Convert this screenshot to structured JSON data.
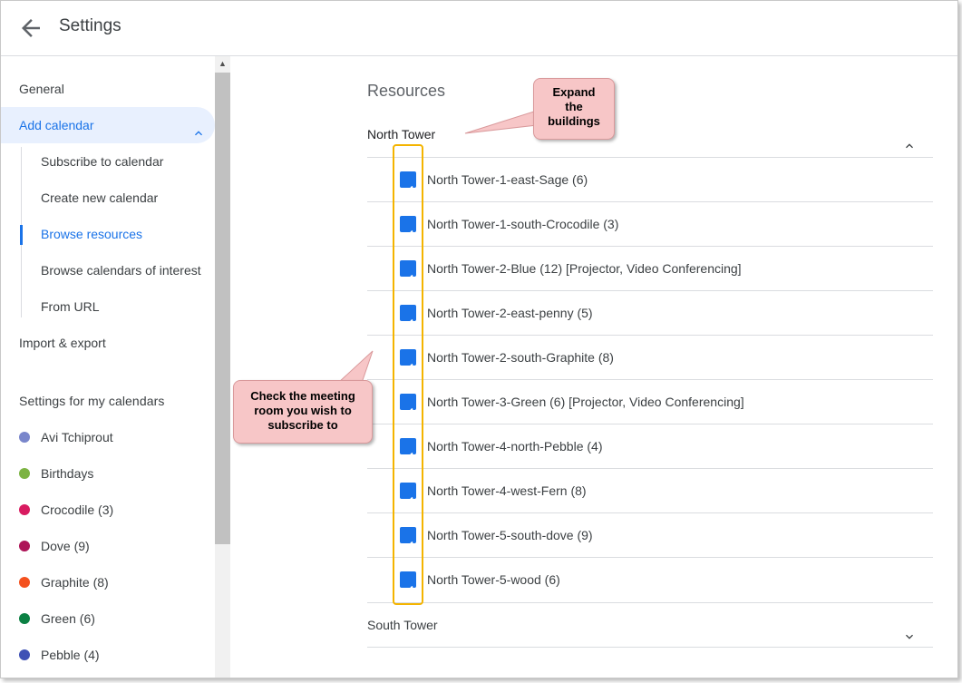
{
  "header": {
    "title": "Settings"
  },
  "sidebar": {
    "items": [
      {
        "label": "General"
      },
      {
        "label": "Add calendar"
      },
      {
        "label": "Subscribe to calendar"
      },
      {
        "label": "Create new calendar"
      },
      {
        "label": "Browse resources"
      },
      {
        "label": "Browse calendars of interest"
      },
      {
        "label": "From URL"
      },
      {
        "label": "Import & export"
      }
    ],
    "section_label": "Settings for my calendars",
    "calendars": [
      {
        "label": "Avi Tchiprout",
        "color": "#7986cb"
      },
      {
        "label": "Birthdays",
        "color": "#7cb342"
      },
      {
        "label": "Crocodile (3)",
        "color": "#d81b60"
      },
      {
        "label": "Dove (9)",
        "color": "#ad1457"
      },
      {
        "label": "Graphite (8)",
        "color": "#f4511e"
      },
      {
        "label": "Green (6)",
        "color": "#0b8043"
      },
      {
        "label": "Pebble (4)",
        "color": "#3f51b5"
      }
    ]
  },
  "main": {
    "title": "Resources",
    "buildings": [
      {
        "name": "North Tower",
        "expanded": true
      },
      {
        "name": "South Tower",
        "expanded": false
      }
    ],
    "rooms": [
      {
        "label": "North Tower-1-east-Sage (6)",
        "checked": true
      },
      {
        "label": "North Tower-1-south-Crocodile (3)",
        "checked": true
      },
      {
        "label": "North Tower-2-Blue (12) [Projector, Video Conferencing]",
        "checked": true
      },
      {
        "label": "North Tower-2-east-penny (5)",
        "checked": true
      },
      {
        "label": "North Tower-2-south-Graphite (8)",
        "checked": true
      },
      {
        "label": "North Tower-3-Green (6) [Projector, Video Conferencing]",
        "checked": true
      },
      {
        "label": "North Tower-4-north-Pebble (4)",
        "checked": true
      },
      {
        "label": "North Tower-4-west-Fern (8)",
        "checked": true
      },
      {
        "label": "North Tower-5-south-dove (9)",
        "checked": true
      },
      {
        "label": "North Tower-5-wood (6)",
        "checked": true
      }
    ]
  },
  "annotations": {
    "callout_1": {
      "line1": "Expand",
      "line2": "the",
      "line3": "buildings"
    },
    "callout_2": {
      "line1": "Check the meeting",
      "line2": "room you wish to",
      "line3": "subscribe to"
    }
  },
  "colors": {
    "accent": "#1a73e8",
    "highlight": "#f4b400",
    "callout": "#f7c6c7"
  }
}
